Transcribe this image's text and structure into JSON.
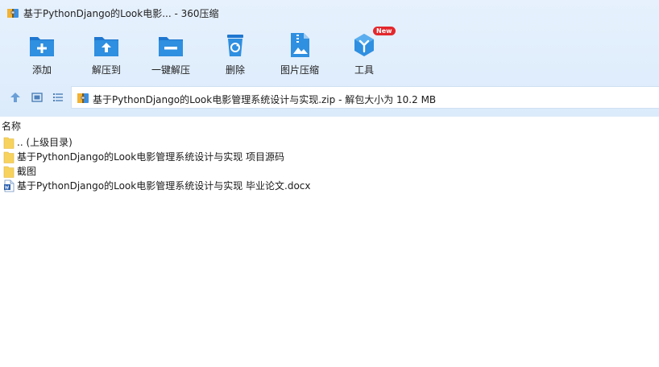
{
  "window": {
    "title": "基于PythonDjango的Look电影... - 360压缩"
  },
  "toolbar": {
    "items": [
      {
        "label": "添加",
        "icon": "add-icon"
      },
      {
        "label": "解压到",
        "icon": "extract-to-icon"
      },
      {
        "label": "一键解压",
        "icon": "one-click-extract-icon"
      },
      {
        "label": "删除",
        "icon": "delete-icon"
      },
      {
        "label": "图片压缩",
        "icon": "image-compress-icon"
      },
      {
        "label": "工具",
        "icon": "tools-icon",
        "badge": "New"
      }
    ]
  },
  "nav": {
    "up_icon": "up-arrow-icon",
    "thumb_view_icon": "thumbnail-view-icon",
    "list_view_icon": "list-view-icon"
  },
  "address": {
    "path": "基于PythonDjango的Look电影管理系统设计与实现.zip - 解包大小为 10.2 MB"
  },
  "list": {
    "column_name": "名称",
    "rows": [
      {
        "name": ".. (上级目录)",
        "type": "folder"
      },
      {
        "name": "基于PythonDjango的Look电影管理系统设计与实现 项目源码",
        "type": "folder"
      },
      {
        "name": "截图",
        "type": "folder"
      },
      {
        "name": "基于PythonDjango的Look电影管理系统设计与实现 毕业论文.docx",
        "type": "docx"
      }
    ]
  },
  "colors": {
    "toolbar_bg": "#dcebfb",
    "icon_blue": "#2f8fe0",
    "folder_yellow": "#f7d25c",
    "badge_red": "#e3272c"
  }
}
